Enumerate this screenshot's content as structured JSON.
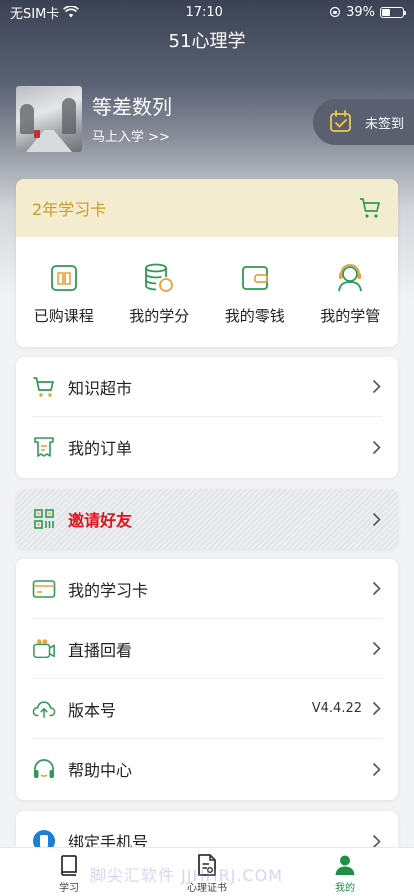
{
  "status_bar": {
    "carrier": "无SIM卡",
    "time": "17:10",
    "battery": "39%",
    "battery_level": 0.39
  },
  "nav": {
    "title": "51心理学"
  },
  "profile": {
    "name": "等差数列",
    "subtitle": "马上入学 >>",
    "checkin_label": "未签到"
  },
  "vip_card": {
    "title": "2年学习卡",
    "quick_items": [
      {
        "label": "已购课程",
        "icon": "book-icon"
      },
      {
        "label": "我的学分",
        "icon": "coins-icon"
      },
      {
        "label": "我的零钱",
        "icon": "wallet-icon"
      },
      {
        "label": "我的学管",
        "icon": "support-agent-icon"
      }
    ]
  },
  "market_list": [
    {
      "label": "知识超市",
      "icon": "cart-icon"
    },
    {
      "label": "我的订单",
      "icon": "receipt-icon"
    }
  ],
  "invite": {
    "label": "邀请好友",
    "icon": "qrcode-icon"
  },
  "more_list": [
    {
      "label": "我的学习卡",
      "icon": "card-icon",
      "value": ""
    },
    {
      "label": "直播回看",
      "icon": "video-icon",
      "value": ""
    },
    {
      "label": "版本号",
      "icon": "cloud-upload-icon",
      "value": "V4.4.22"
    },
    {
      "label": "帮助中心",
      "icon": "headset-icon",
      "value": ""
    }
  ],
  "phone_row": {
    "label": "绑定手机号",
    "icon": "phone-icon"
  },
  "tabbar": [
    {
      "label": "学习",
      "icon": "book-tab-icon",
      "active": false
    },
    {
      "label": "心理证书",
      "icon": "certificate-tab-icon",
      "active": false
    },
    {
      "label": "我的",
      "icon": "user-tab-icon",
      "active": true
    }
  ],
  "watermark": "脚尖汇软件 JJHHRJ.COM",
  "colors": {
    "accent_green": "#1f8e47",
    "gold": "#c89c2a",
    "invite_red": "#e0121a",
    "icon_orange": "#e8a23a"
  }
}
